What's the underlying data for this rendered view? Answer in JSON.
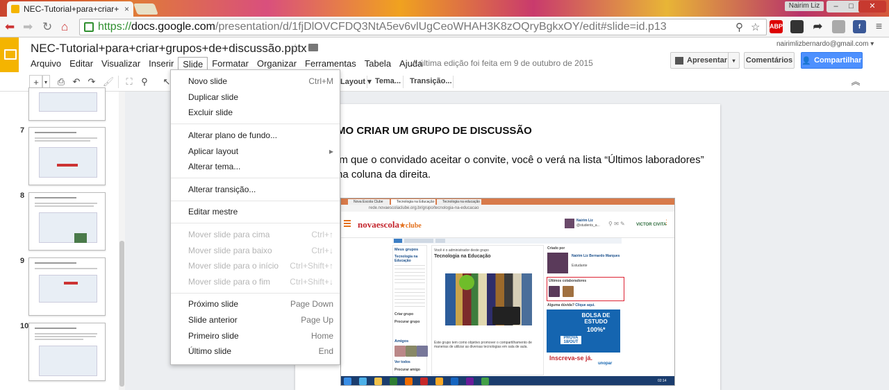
{
  "browser": {
    "tab_title": "NEC-Tutorial+para+criar+",
    "tab_close": "×",
    "user": "Nairim Liz",
    "window_controls": [
      "–",
      "□",
      "✕"
    ],
    "url_scheme": "https://",
    "url_host": "docs.google.com",
    "url_path": "/presentation/d/1fjDlOVCFDQ3NtA5ev6vlUgCeoWHAH3K8zOQryBgkxOY/edit#slide=id.p13",
    "ext_abp": "ABP"
  },
  "doc": {
    "title": "NEC-Tutorial+para+criar+grupos+de+discussão.pptx",
    "account": "nairimlizbernardo@gmail.com",
    "last_edit": "A última edição foi feita em 9 de outubro de 2015",
    "menu": [
      "Arquivo",
      "Editar",
      "Visualizar",
      "Inserir",
      "Slide",
      "Formatar",
      "Organizar",
      "Ferramentas",
      "Tabela",
      "Ajuda"
    ],
    "present_label": "Apresentar",
    "comments_label": "Comentários",
    "share_label": "Compartilhar"
  },
  "edit_toolbar": {
    "layout_label": "Layout ▾",
    "theme_label": "Tema...",
    "transition_label": "Transição..."
  },
  "filmstrip": {
    "slide_numbers": [
      "7",
      "8",
      "9",
      "10"
    ]
  },
  "slide_menu": {
    "items": [
      {
        "label": "Novo slide",
        "shortcut": "Ctrl+M"
      },
      {
        "label": "Duplicar slide",
        "shortcut": ""
      },
      {
        "label": "Excluir slide",
        "shortcut": ""
      },
      {
        "label": "Alterar plano de fundo...",
        "shortcut": ""
      },
      {
        "label": "Aplicar layout",
        "shortcut": "▸"
      },
      {
        "label": "Alterar tema...",
        "shortcut": ""
      },
      {
        "label": "Alterar transição...",
        "shortcut": ""
      },
      {
        "label": "Editar mestre",
        "shortcut": ""
      },
      {
        "label": "Mover slide para cima",
        "shortcut": "Ctrl+↑"
      },
      {
        "label": "Mover slide para baixo",
        "shortcut": "Ctrl+↓"
      },
      {
        "label": "Mover slide para o início",
        "shortcut": "Ctrl+Shift+↑"
      },
      {
        "label": "Mover slide para o fim",
        "shortcut": "Ctrl+Shift+↓"
      },
      {
        "label": "Próximo slide",
        "shortcut": "Page Down"
      },
      {
        "label": "Slide anterior",
        "shortcut": "Page Up"
      },
      {
        "label": "Primeiro slide",
        "shortcut": "Home"
      },
      {
        "label": "Último slide",
        "shortcut": "End"
      }
    ]
  },
  "slide": {
    "heading": "MO CRIAR UM GRUPO DE DISCUSSÃO",
    "body": "im que o convidado aceitar o convite, você o verá na lista “Últimos laboradores” na coluna da direita."
  },
  "embedded_screenshot": {
    "tabs": [
      "Nova Escola Clube",
      "Tecnologia na Educação",
      "Tecnologia na educação"
    ],
    "address": "rede.novaescolaclube.org.br/grupo/tecnologia-na-educacao",
    "logo_main": "novaescola",
    "logo_sub": "★clube",
    "user_name": "Nairim Liz",
    "user_sub": "@students_a...",
    "sponsor": "VICTOR CIVITA",
    "sidebar_title": "Meus grupos",
    "sidebar_group": "Tecnologia na Educação",
    "criar_grupo": "Criar grupo",
    "procurar_grupo": "Procurar grupo",
    "amigos": "Amigos",
    "ver_todos": "Ver todos",
    "procurar_amigo": "Procurar amigo",
    "admin_note": "Você é o administrador deste grupo",
    "group_title": "Tecnologia na Educação",
    "group_desc": "Este grupo tem como objetivo promover o compartilhamento de maneiras de utilizar as diversas tecnologias em sala de aula.",
    "created_by": "Criado por",
    "creator": "Nairim Liz Bernardo Marques",
    "creator_role": "Estudante",
    "last_collab": "Últimos colaboradores",
    "question": "Alguma dúvida?",
    "click_here": "Clique aqui.",
    "ad_title": "BOLSA DE ESTUDO",
    "ad_pct": "100%*",
    "ad_prova": "PROVA 18/OUT",
    "ad_cta": "Inscreva-se já.",
    "ad_brand": "unopar",
    "clock": "02:14"
  },
  "colors": {
    "slides_yellow": "#f4b400",
    "share_blue": "#4d90fe",
    "nova_escola_red": "#c4262e"
  }
}
